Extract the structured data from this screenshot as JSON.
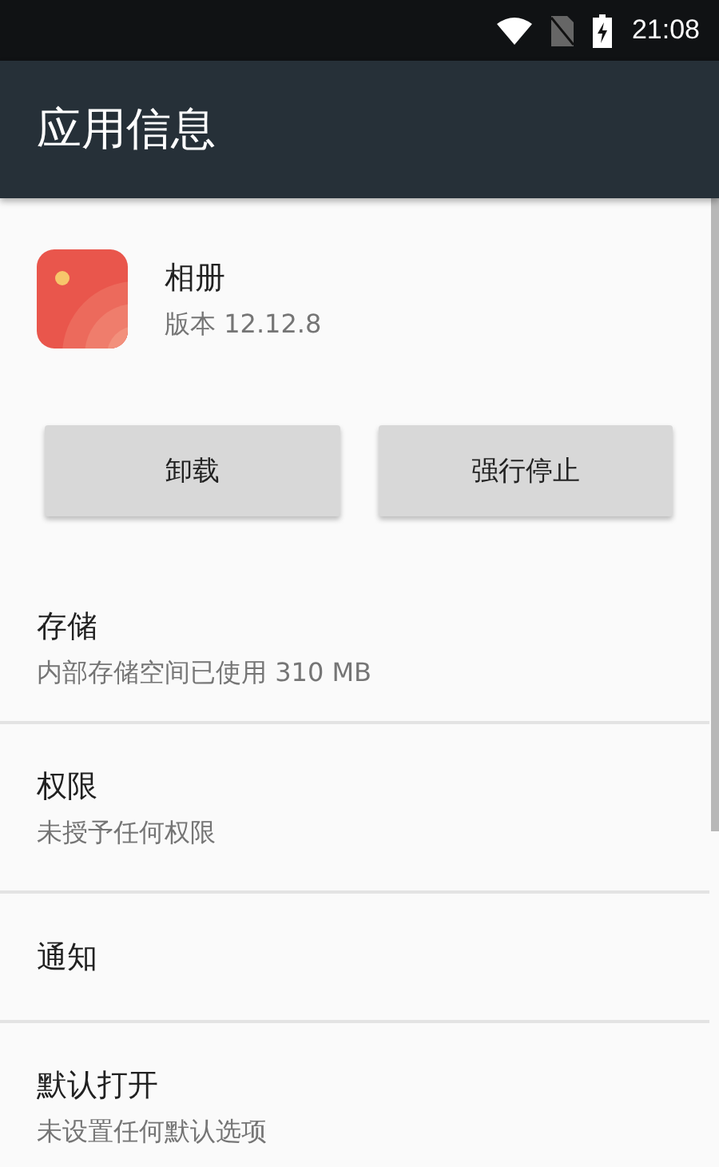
{
  "status_bar": {
    "time": "21:08"
  },
  "app_bar": {
    "title": "应用信息"
  },
  "app": {
    "name": "相册",
    "version": "版本 12.12.8"
  },
  "buttons": [
    "卸载",
    "强行停止"
  ],
  "sections": [
    {
      "title": "存储",
      "subtitle": "内部存储空间已使用 310 MB"
    },
    {
      "title": "权限",
      "subtitle": "未授予任何权限"
    },
    {
      "title": "通知"
    },
    {
      "title": "默认打开",
      "subtitle": "未设置任何默认选项"
    }
  ]
}
